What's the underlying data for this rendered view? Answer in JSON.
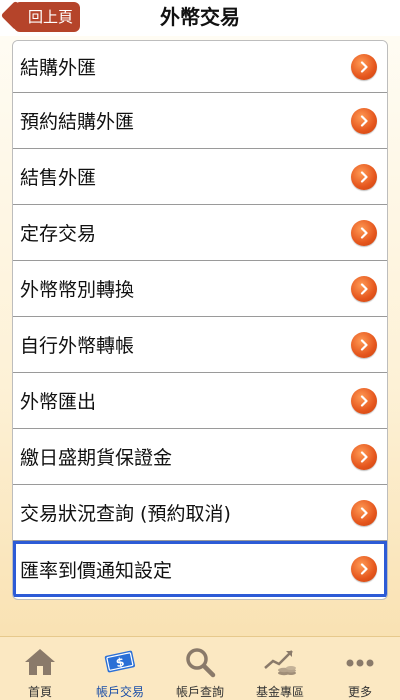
{
  "header": {
    "back_label": "回上頁",
    "title": "外幣交易"
  },
  "menu": {
    "items": [
      {
        "label": "結購外匯"
      },
      {
        "label": "預約結購外匯"
      },
      {
        "label": "結售外匯"
      },
      {
        "label": "定存交易"
      },
      {
        "label": "外幣幣別轉換"
      },
      {
        "label": "自行外幣轉帳"
      },
      {
        "label": "外幣匯出"
      },
      {
        "label": "繳日盛期貨保證金"
      },
      {
        "label": "交易狀況查詢 (預約取消)"
      },
      {
        "label": "匯率到價通知設定"
      }
    ],
    "selected_index": 9
  },
  "tabs": [
    {
      "label": "首頁",
      "icon": "home-icon"
    },
    {
      "label": "帳戶交易",
      "icon": "banknote-icon",
      "active": true
    },
    {
      "label": "帳戶查詢",
      "icon": "magnifier-icon"
    },
    {
      "label": "基金專區",
      "icon": "chart-coins-icon"
    },
    {
      "label": "更多",
      "icon": "more-dots-icon"
    }
  ],
  "colors": {
    "accent": "#b5442a",
    "chevron": "#e5561d",
    "selection": "#2d5bd6",
    "tabbar_bg": "#fbe8c2",
    "active_tab": "#1a4ea8"
  }
}
